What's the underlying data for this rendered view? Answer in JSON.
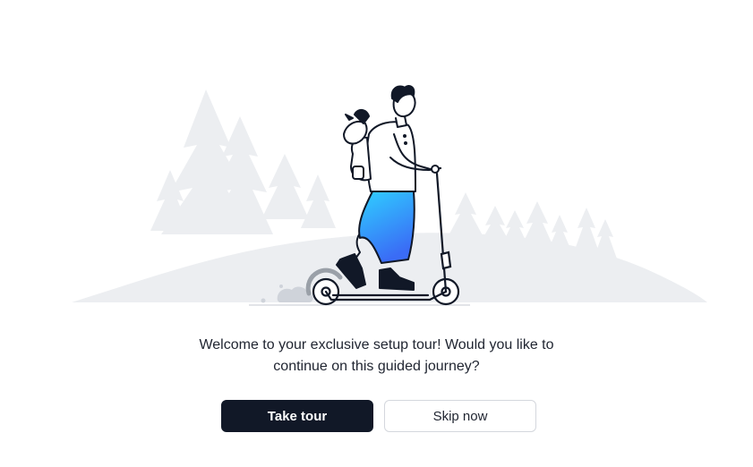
{
  "dialog": {
    "message_line1": "Welcome to your exclusive setup tour! Would you like to",
    "message_line2": "continue on this guided journey?",
    "primary_button_label": "Take tour",
    "secondary_button_label": "Skip now"
  },
  "illustration": {
    "icon": "scooter-rider-illustration",
    "colors": {
      "ink": "#111827",
      "shorts_gradient_start": "#2fd0ff",
      "shorts_gradient_end": "#3a6cf6",
      "background_trees": "#e9ebee"
    }
  }
}
